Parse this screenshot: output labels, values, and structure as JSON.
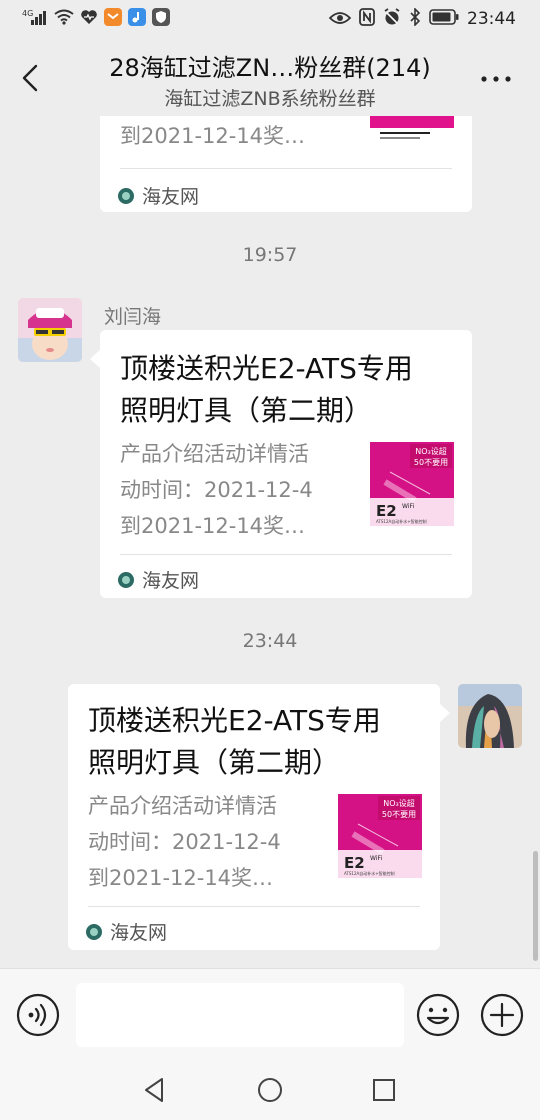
{
  "status_bar": {
    "signal_label": "4G",
    "time": "23:44"
  },
  "header": {
    "title": "28海缸过滤ZN…粉丝群(214)",
    "subtitle": "海缸过滤ZNB系统粉丝群",
    "back_icon": "chevron-left-icon",
    "more_icon": "more-icon"
  },
  "chat": {
    "messages": [
      {
        "desc_line_last": "到2021-12-14奖…",
        "source": "海友网"
      },
      {
        "time": "19:57",
        "sender": "刘闫海",
        "title_line1": "顶楼送积光E2-ATS专用",
        "title_line2": "照明灯具（第二期）",
        "desc_line1": "产品介绍活动详情活",
        "desc_line2": "动时间：2021-12-4",
        "desc_line3": "到2021-12-14奖…",
        "source": "海友网"
      },
      {
        "time": "23:44",
        "title_line1": "顶楼送积光E2-ATS专用",
        "title_line2": "照明灯具（第二期）",
        "desc_line1": "产品介绍活动详情活",
        "desc_line2": "动时间：2021-12-4",
        "desc_line3": "到2021-12-14奖…",
        "source": "海友网"
      }
    ],
    "thumb_text": {
      "promo_line1": "NO₃设超",
      "promo_line2": "50不要用",
      "model": "E2",
      "model_sub": "WiFi",
      "fine_print": "ATS12A自动补水+智能控制"
    }
  },
  "input_bar": {
    "input_value": "",
    "voice_icon": "voice-icon",
    "emoji_icon": "emoji-icon",
    "plus_icon": "plus-icon"
  },
  "nav_bar": {
    "back_icon": "triangle-back-icon",
    "home_icon": "circle-home-icon",
    "recents_icon": "square-recents-icon"
  },
  "colors": {
    "background": "#ededed",
    "card": "#ffffff",
    "thumb_accent": "#e0138c",
    "source_icon": "#2b6b63"
  }
}
